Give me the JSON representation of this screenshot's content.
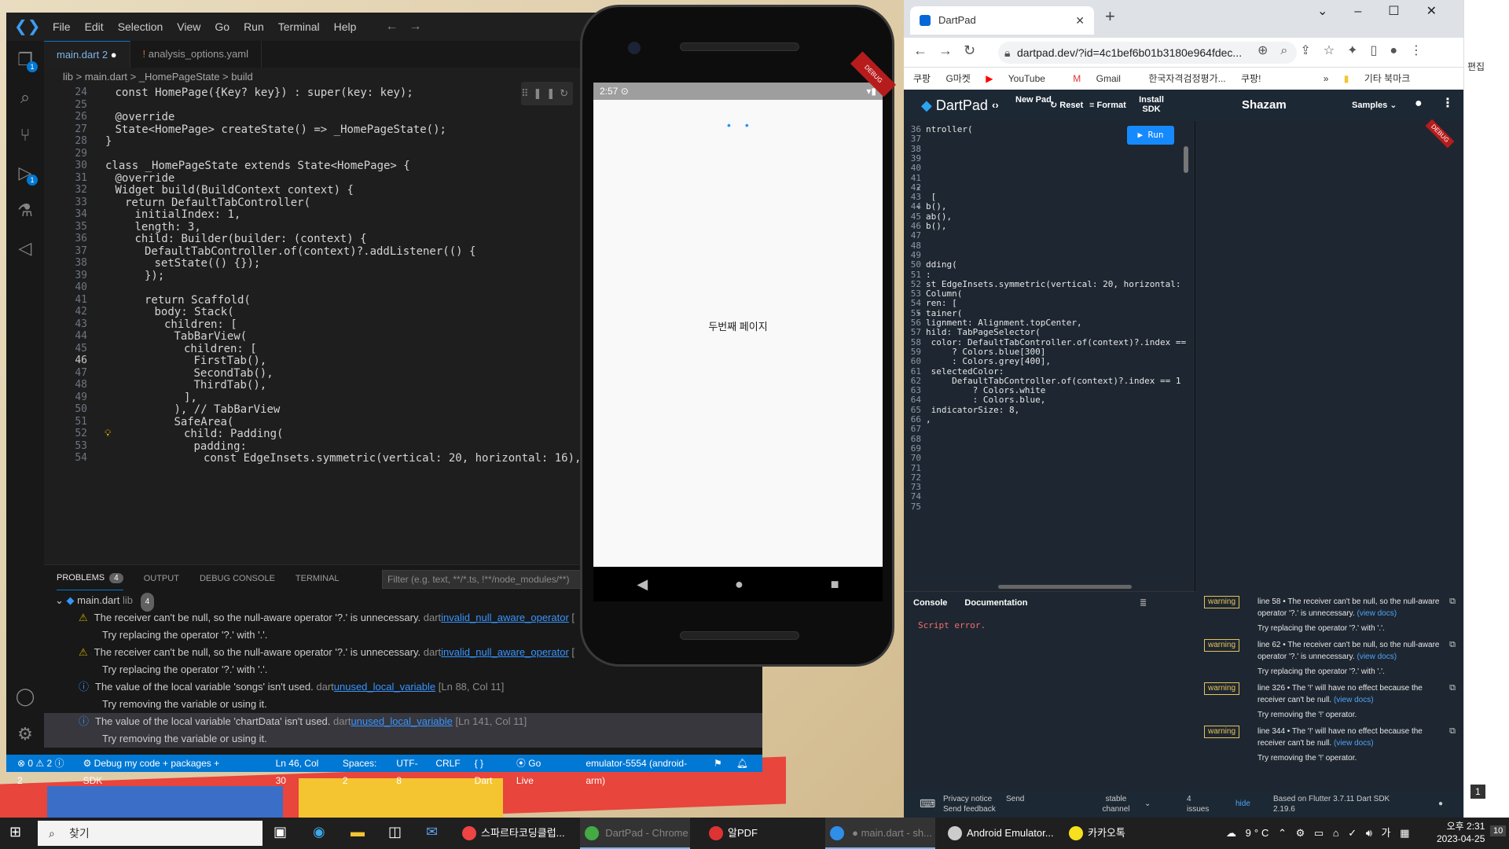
{
  "vscode": {
    "menu": [
      "File",
      "Edit",
      "Selection",
      "View",
      "Go",
      "Run",
      "Terminal",
      "Help"
    ],
    "tabs": [
      {
        "label": "main.dart",
        "suffix": "2",
        "modified": "●"
      },
      {
        "label": "analysis_options.yaml",
        "prefix": "!"
      }
    ],
    "breadcrumb": "lib > main.dart > _HomePageState > build",
    "activity_badges": [
      "1",
      "1"
    ],
    "code_lines": [
      {
        "n": "24",
        "t": "const HomePage({Key? key}) : super(key: key);"
      },
      {
        "n": "25",
        "t": ""
      },
      {
        "n": "26",
        "t": "@override"
      },
      {
        "n": "27",
        "t": "State<HomePage> createState() => _HomePageState();"
      },
      {
        "n": "28",
        "t": "}"
      },
      {
        "n": "29",
        "t": ""
      },
      {
        "n": "30",
        "t": "class _HomePageState extends State<HomePage> {"
      },
      {
        "n": "31",
        "t": "@override"
      },
      {
        "n": "32",
        "t": "Widget build(BuildContext context) {"
      },
      {
        "n": "33",
        "t": "return DefaultTabController("
      },
      {
        "n": "34",
        "t": "initialIndex: 1,"
      },
      {
        "n": "35",
        "t": "length: 3,"
      },
      {
        "n": "36",
        "t": "child: Builder(builder: (context) {"
      },
      {
        "n": "37",
        "t": "DefaultTabController.of(context)?.addListener(() {"
      },
      {
        "n": "38",
        "t": "setState(() {});"
      },
      {
        "n": "39",
        "t": "});"
      },
      {
        "n": "40",
        "t": ""
      },
      {
        "n": "41",
        "t": "return Scaffold("
      },
      {
        "n": "42",
        "t": "body: Stack("
      },
      {
        "n": "43",
        "t": "children: ["
      },
      {
        "n": "44",
        "t": "TabBarView("
      },
      {
        "n": "45",
        "t": "children: ["
      },
      {
        "n": "46",
        "t": "FirstTab(),"
      },
      {
        "n": "47",
        "t": "SecondTab(),"
      },
      {
        "n": "48",
        "t": "ThirdTab(),"
      },
      {
        "n": "49",
        "t": "],"
      },
      {
        "n": "50",
        "t": "), // TabBarView"
      },
      {
        "n": "51",
        "t": "SafeArea("
      },
      {
        "n": "52",
        "t": "child: Padding("
      },
      {
        "n": "53",
        "t": "padding:"
      },
      {
        "n": "54",
        "t": "const EdgeInsets.symmetric(vertical: 20, horizontal: 16),"
      }
    ],
    "panel": {
      "tabs": [
        "PROBLEMS",
        "OUTPUT",
        "DEBUG CONSOLE",
        "TERMINAL"
      ],
      "problems_count": "4",
      "filter_placeholder": "Filter (e.g. text, **/*.ts, !**/node_modules/**)",
      "file": "main.dart",
      "file_dir": "lib",
      "file_count": "4",
      "problems": [
        {
          "type": "warning",
          "msg": "The receiver can't be null, so the null-aware operator '?.' is unnecessary.",
          "src": "dart",
          "code": "invalid_null_aware_operator",
          "loc": "[",
          "fix": "Try replacing the operator '?.' with '.'."
        },
        {
          "type": "warning",
          "msg": "The receiver can't be null, so the null-aware operator '?.' is unnecessary.",
          "src": "dart",
          "code": "invalid_null_aware_operator",
          "loc": "[",
          "fix": "Try replacing the operator '?.' with '.'."
        },
        {
          "type": "info",
          "msg": "The value of the local variable 'songs' isn't used.",
          "src": "dart",
          "code": "unused_local_variable",
          "loc": "[Ln 88, Col 11]",
          "fix": "Try removing the variable or using it."
        },
        {
          "type": "info",
          "msg": "The value of the local variable 'chartData' isn't used.",
          "src": "dart",
          "code": "unused_local_variable",
          "loc": "[Ln 141, Col 11]",
          "fix": "Try removing the variable or using it."
        }
      ]
    },
    "status": {
      "errors": "⊗ 0 ⚠ 2 ⓘ 2",
      "debug": "Debug my code + packages + SDK",
      "pos": "Ln 46, Col 30",
      "spaces": "Spaces: 2",
      "enc": "UTF-8",
      "eol": "CRLF",
      "lang": "{ } Dart",
      "live": "Go Live",
      "device": "emulator-5554 (android-arm)"
    }
  },
  "emulator": {
    "time": "2:57",
    "page_text": "두번째 페이지",
    "debug": "DEBUG"
  },
  "chrome": {
    "tab_title": "DartPad",
    "url": "dartpad.dev/?id=4c1bef6b01b3180e964fdec...",
    "bookmarks": [
      "쿠팡",
      "G마켓",
      "YouTube",
      "Gmail",
      "한국자격검정평가...",
      "쿠팡!",
      "»",
      "기타 북마크"
    ]
  },
  "dartpad": {
    "logo": "DartPad",
    "new_pad": "New Pad",
    "reset": "Reset",
    "format": "Format",
    "install_sdk": "Install SDK",
    "title": "Shazam",
    "samples": "Samples",
    "run": "▶  Run",
    "debug": "DEBUG",
    "code_lines": [
      {
        "n": "36",
        "t": "ntroller("
      },
      {
        "n": "37",
        "t": ""
      },
      {
        "n": "38",
        "t": ""
      },
      {
        "n": "39",
        "t": ""
      },
      {
        "n": "40",
        "t": ""
      },
      {
        "n": "41 ▾",
        "t": ""
      },
      {
        "n": "42",
        "t": ""
      },
      {
        "n": "43 ▾",
        "t": " ["
      },
      {
        "n": "44",
        "t": "b(),"
      },
      {
        "n": "45",
        "t": "ab(),"
      },
      {
        "n": "46",
        "t": "b(),"
      },
      {
        "n": "47",
        "t": ""
      },
      {
        "n": "48",
        "t": ""
      },
      {
        "n": "49",
        "t": ""
      },
      {
        "n": "50",
        "t": "dding("
      },
      {
        "n": "51",
        "t": ":"
      },
      {
        "n": "52",
        "t": "st EdgeInsets.symmetric(vertical: 20, horizontal:"
      },
      {
        "n": "53",
        "t": "Column("
      },
      {
        "n": "54 ▾",
        "t": "ren: ["
      },
      {
        "n": "55",
        "t": "tainer("
      },
      {
        "n": "56",
        "t": "lignment: Alignment.topCenter,"
      },
      {
        "n": "57",
        "t": "hild: TabPageSelector("
      },
      {
        "n": "58",
        "t": " color: DefaultTabController.of(context)?.index =="
      },
      {
        "n": "59",
        "t": "     ? Colors.blue[300]"
      },
      {
        "n": "60",
        "t": "     : Colors.grey[400],"
      },
      {
        "n": "61",
        "t": " selectedColor:"
      },
      {
        "n": "62",
        "t": "     DefaultTabController.of(context)?.index == 1"
      },
      {
        "n": "63",
        "t": "         ? Colors.white"
      },
      {
        "n": "64",
        "t": "         : Colors.blue,"
      },
      {
        "n": "65",
        "t": " indicatorSize: 8,"
      },
      {
        "n": "66",
        "t": ","
      },
      {
        "n": "67",
        "t": ""
      },
      {
        "n": "68",
        "t": ""
      },
      {
        "n": "69",
        "t": ""
      },
      {
        "n": "70",
        "t": ""
      },
      {
        "n": "71",
        "t": ""
      },
      {
        "n": "72",
        "t": ""
      },
      {
        "n": "73",
        "t": ""
      },
      {
        "n": "74",
        "t": ""
      },
      {
        "n": "75",
        "t": ""
      }
    ],
    "console_tabs": [
      "Console",
      "Documentation"
    ],
    "console_error": "Script error.",
    "issues": [
      {
        "badge": "warning",
        "text": "line 58 • The receiver can't be null, so the null-aware operator '?.' is unnecessary.",
        "link": "(view docs)",
        "fix": "Try replacing the operator '?.' with '.'."
      },
      {
        "badge": "warning",
        "text": "line 62 • The receiver can't be null, so the null-aware operator '?.' is unnecessary.",
        "link": "(view docs)",
        "fix": "Try replacing the operator '?.' with '.'."
      },
      {
        "badge": "warning",
        "text": "line 326 • The '!' will have no effect because the receiver can't be null.",
        "link": "(view docs)",
        "fix": "Try removing the '!' operator."
      },
      {
        "badge": "warning",
        "text": "line 344 • The '!' will have no effect because the receiver can't be null.",
        "link": "(view docs)",
        "fix": "Try removing the '!' operator."
      }
    ],
    "footer": {
      "privacy": "Privacy notice",
      "feedback": "Send feedback",
      "channel": "stable channel",
      "issues": "4 issues",
      "hide": "hide",
      "sdk": "Based on Flutter 3.7.11 Dart SDK 2.19.6"
    }
  },
  "right_strip": {
    "edit": "편집",
    "page": "1"
  },
  "taskbar": {
    "search": "찾기",
    "apps": [
      "스파르타코딩클럽...",
      "DartPad - Chrome",
      "알PDF",
      "main.dart - sh...",
      "Android Emulator...",
      "카카오톡"
    ],
    "weather": "9°C",
    "ime": "가",
    "time": "오후 2:31",
    "date": "2023-04-25",
    "notif": "10"
  }
}
